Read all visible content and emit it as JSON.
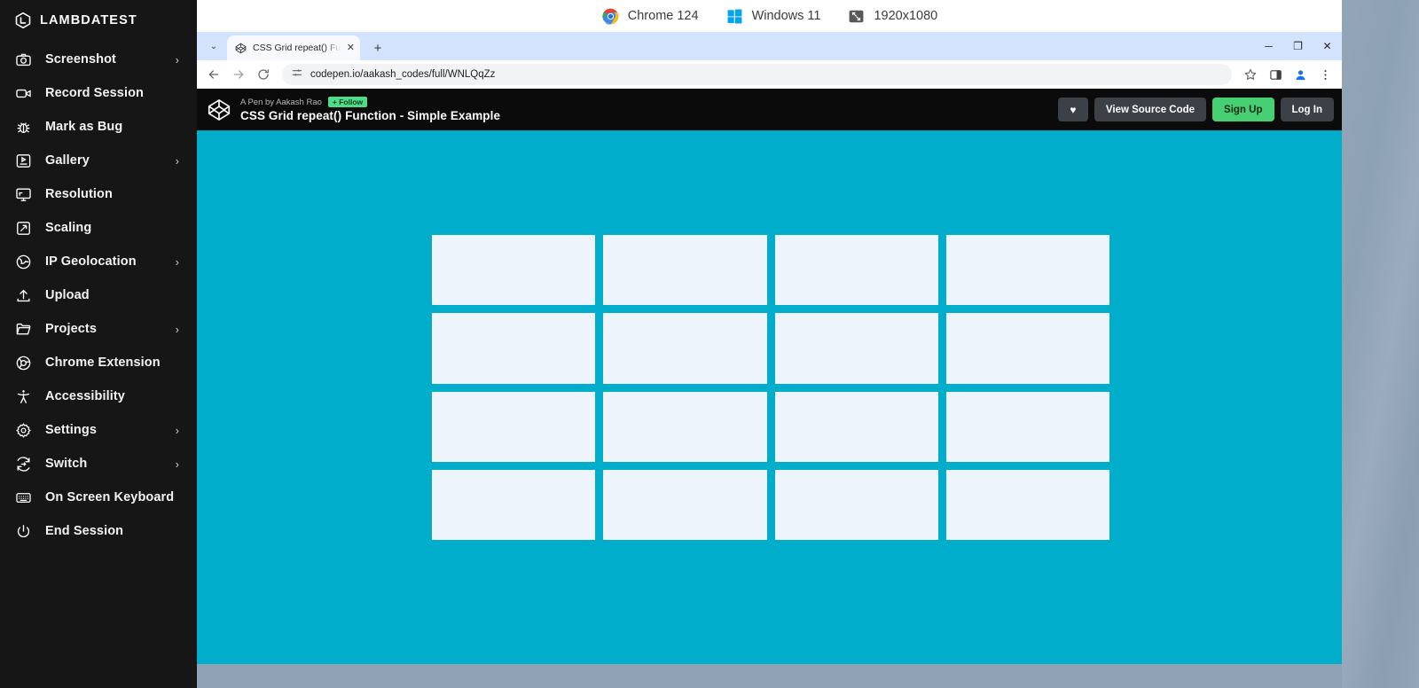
{
  "sidebar": {
    "brand": "LAMBDATEST",
    "brand_icon": "lambdatest-logo-icon",
    "items": [
      {
        "label": "Screenshot",
        "icon": "camera-icon",
        "chevron": "›"
      },
      {
        "label": "Record Session",
        "icon": "video-camera-icon",
        "chevron": ""
      },
      {
        "label": "Mark as Bug",
        "icon": "bug-icon",
        "chevron": ""
      },
      {
        "label": "Gallery",
        "icon": "gallery-icon",
        "chevron": "›"
      },
      {
        "label": "Resolution",
        "icon": "monitor-icon",
        "chevron": ""
      },
      {
        "label": "Scaling",
        "icon": "scale-arrow-icon",
        "chevron": ""
      },
      {
        "label": "IP Geolocation",
        "icon": "globe-icon",
        "chevron": "›"
      },
      {
        "label": "Upload",
        "icon": "upload-icon",
        "chevron": ""
      },
      {
        "label": "Projects",
        "icon": "folder-icon",
        "chevron": "›"
      },
      {
        "label": "Chrome Extension",
        "icon": "chrome-icon",
        "chevron": ""
      },
      {
        "label": "Accessibility",
        "icon": "accessibility-icon",
        "chevron": ""
      },
      {
        "label": "Settings",
        "icon": "gear-icon",
        "chevron": "›"
      },
      {
        "label": "Switch",
        "icon": "switch-arrows-icon",
        "chevron": "›"
      },
      {
        "label": "On Screen Keyboard",
        "icon": "keyboard-icon",
        "chevron": ""
      },
      {
        "label": "End Session",
        "icon": "power-icon",
        "chevron": ""
      }
    ]
  },
  "topbar": {
    "browser": "Chrome 124",
    "os": "Windows 11",
    "resolution": "1920x1080"
  },
  "browser": {
    "tab": {
      "title": "CSS Grid repeat() Function - Si",
      "favicon": "codepen-favicon-icon",
      "close": "✕"
    },
    "new_tab": "+",
    "tab_list_chevron": "⌄",
    "window_controls": {
      "minimize": "─",
      "maximize": "❐",
      "close": "✕"
    },
    "toolbar": {
      "back": "←",
      "forward": "→",
      "reload": "↻",
      "site_info": "tune-icon",
      "url": "codepen.io/aakash_codes/full/WNLQqZz",
      "bookmark": "☆",
      "side_panel": "side-panel-icon",
      "profile": "profile-avatar-icon",
      "menu": "⋮"
    }
  },
  "codepen": {
    "logo": "codepen-logo-icon",
    "byline": "A Pen by Aakash Rao",
    "follow_label": "+ Follow",
    "pen_title": "CSS Grid repeat() Function - Simple Example",
    "heart_label": "♥",
    "view_source_label": "View Source Code",
    "signup_label": "Sign Up",
    "login_label": "Log In"
  },
  "pen": {
    "background_color": "#00aecb",
    "cell_color": "#eef4fc",
    "columns": 4,
    "rows": 4,
    "cells": [
      "",
      "",
      "",
      "",
      "",
      "",
      "",
      "",
      "",
      "",
      "",
      "",
      "",
      "",
      "",
      ""
    ]
  }
}
